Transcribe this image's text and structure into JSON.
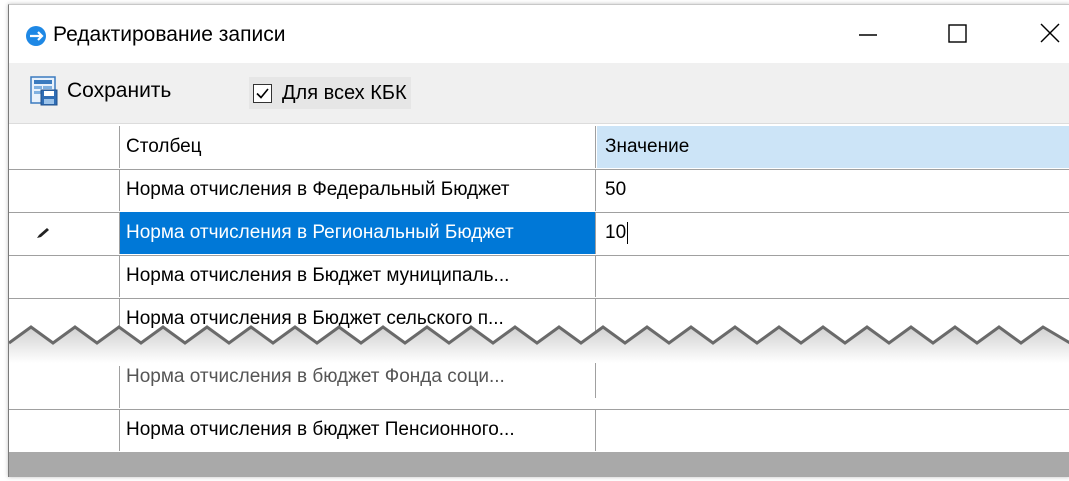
{
  "window": {
    "title": "Редактирование записи",
    "app_icon": "app-logo-icon",
    "controls": [
      "minimize-icon",
      "maximize-icon",
      "close-icon"
    ]
  },
  "toolbar": {
    "save_label": "Сохранить",
    "save_icon": "save-icon",
    "checkbox_label": "Для всех КБК",
    "checkbox_checked": true
  },
  "grid": {
    "headers": {
      "column": "Столбец",
      "value": "Значение"
    },
    "rows": [
      {
        "column": "Норма отчисления в Федеральный Бюджет",
        "value": "50"
      },
      {
        "column": "Норма отчисления в Региональный Бюджет",
        "value": "10",
        "selected": true,
        "editing": true
      },
      {
        "column": "Норма отчисления в Бюджет муниципаль...",
        "value": ""
      },
      {
        "column": "Норма отчисления в Бюджет сельского п...",
        "value": ""
      },
      {
        "column": "Норма отчисления в бюджет Фонда соци...",
        "value": ""
      },
      {
        "column": "Норма отчисления в бюджет Пенсионного...",
        "value": ""
      }
    ]
  },
  "colors": {
    "selection": "#0078d7",
    "header_value_bg": "#cce4f7",
    "footer_bar": "#a9a9a9"
  }
}
